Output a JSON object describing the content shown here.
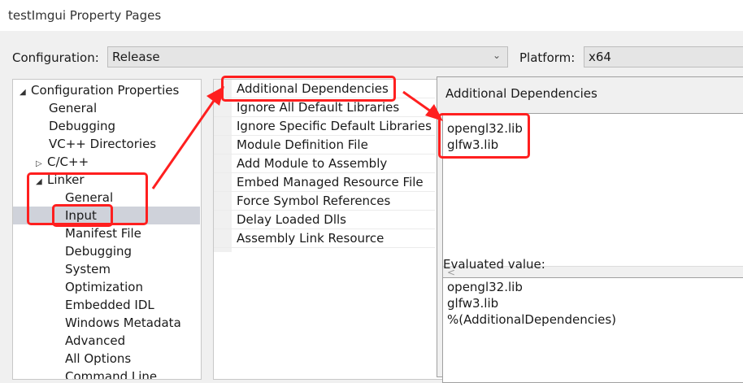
{
  "window": {
    "title": "testImgui Property Pages"
  },
  "config": {
    "configuration_label": "Configuration:",
    "configuration_value": "Release",
    "platform_label": "Platform:",
    "platform_value": "x64"
  },
  "tree": {
    "items": [
      {
        "label": "Configuration Properties",
        "expander": "◢"
      },
      {
        "label": "General"
      },
      {
        "label": "Debugging"
      },
      {
        "label": "VC++ Directories"
      },
      {
        "label": "C/C++",
        "expander": "▷"
      },
      {
        "label": "Linker",
        "expander": "◢"
      },
      {
        "label": "General"
      },
      {
        "label": "Input"
      },
      {
        "label": "Manifest File"
      },
      {
        "label": "Debugging"
      },
      {
        "label": "System"
      },
      {
        "label": "Optimization"
      },
      {
        "label": "Embedded IDL"
      },
      {
        "label": "Windows Metadata"
      },
      {
        "label": "Advanced"
      },
      {
        "label": "All Options"
      },
      {
        "label": "Command Line"
      }
    ]
  },
  "properties": {
    "items": [
      "Additional Dependencies",
      "Ignore All Default Libraries",
      "Ignore Specific Default Libraries",
      "Module Definition File",
      "Add Module to Assembly",
      "Embed Managed Resource File",
      "Force Symbol References",
      "Delay Loaded Dlls",
      "Assembly Link Resource"
    ]
  },
  "dialog": {
    "title": "Additional Dependencies",
    "edit_lines": [
      "opengl32.lib",
      "glfw3.lib"
    ],
    "scroll_left": "<",
    "evaluated_label": "Evaluated value:",
    "evaluated_lines": [
      "opengl32.lib",
      "glfw3.lib",
      "%(AdditionalDependencies)"
    ]
  },
  "annotation_color": "#ff1f1f"
}
